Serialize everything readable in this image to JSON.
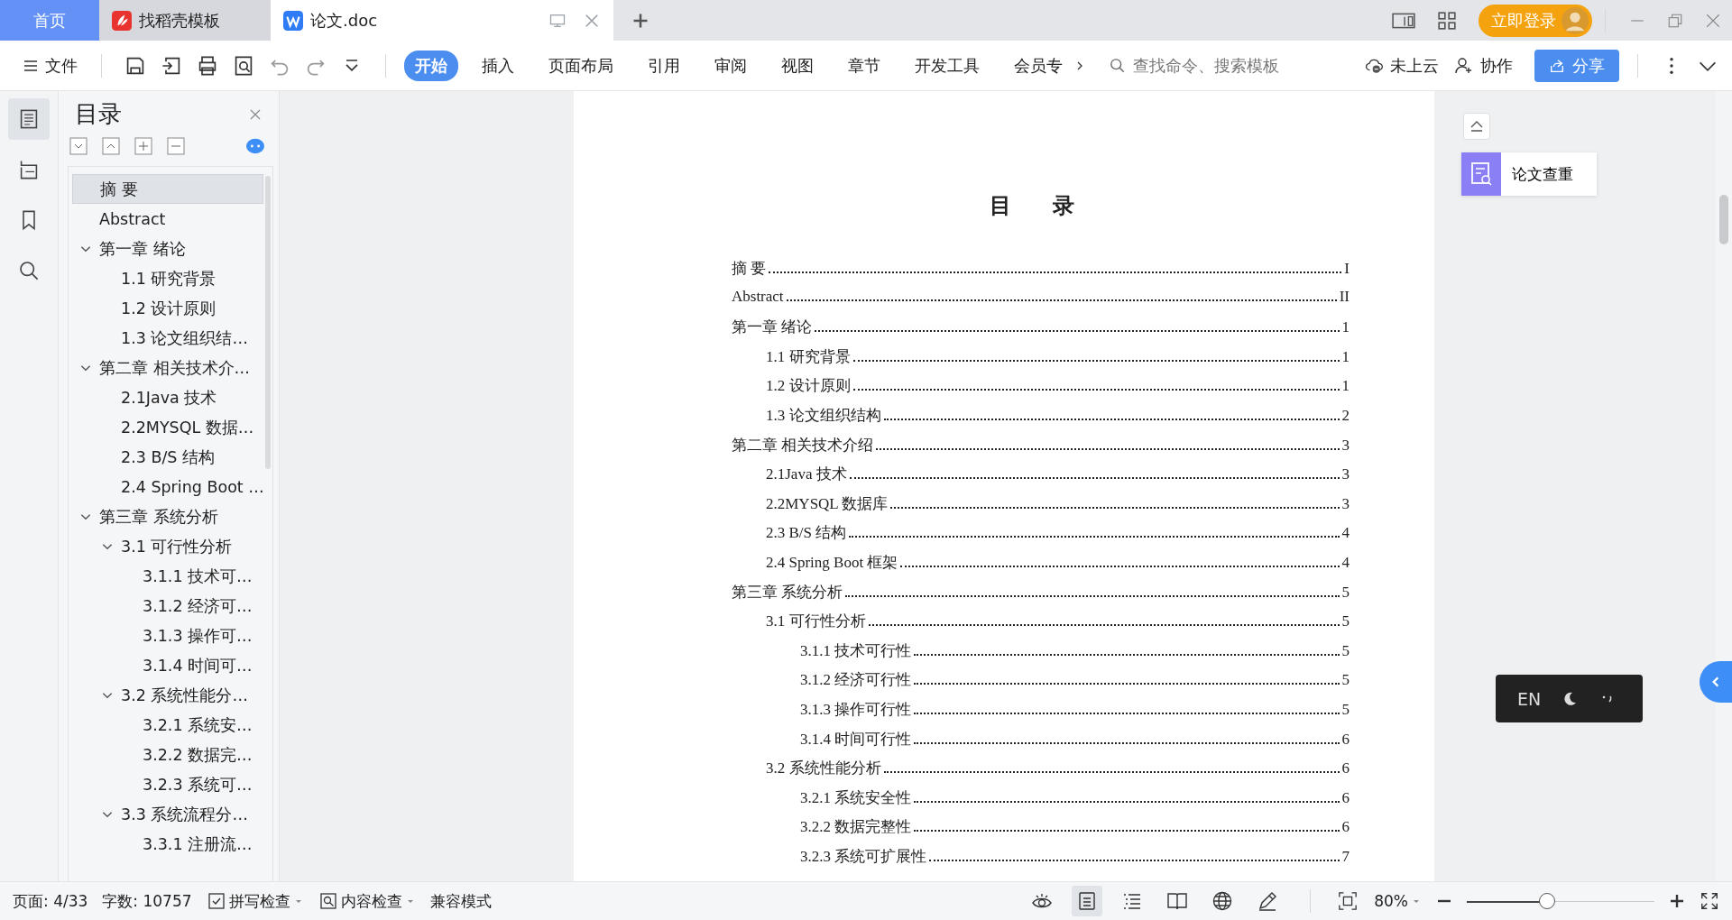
{
  "tabs": [
    {
      "label": "首页",
      "kind": "home",
      "selected": false
    },
    {
      "label": "找稻壳模板",
      "kind": "template",
      "selected": false
    },
    {
      "label": "论文.doc",
      "kind": "doc",
      "selected": true
    }
  ],
  "account": {
    "login": "立即登录"
  },
  "toolbar": {
    "file": "文件",
    "menus": [
      {
        "label": "开始",
        "selected": true
      },
      {
        "label": "插入",
        "selected": false
      },
      {
        "label": "页面布局",
        "selected": false
      },
      {
        "label": "引用",
        "selected": false
      },
      {
        "label": "审阅",
        "selected": false
      },
      {
        "label": "视图",
        "selected": false
      },
      {
        "label": "章节",
        "selected": false
      },
      {
        "label": "开发工具",
        "selected": false
      },
      {
        "label": "会员专",
        "selected": false
      }
    ],
    "search": {
      "placeholder": "查找命令、搜索模板"
    },
    "cloud": "未上云",
    "collab": "协作",
    "share": "分享"
  },
  "nav": {
    "title": "目录",
    "items": [
      {
        "label": "摘 要",
        "selected": true
      },
      {
        "label": "Abstract",
        "selected": false
      },
      {
        "label": "第一章 绪论",
        "selected": false,
        "expanded": true,
        "children": [
          {
            "label": "1.1 研究背景",
            "selected": false
          },
          {
            "label": "1.2  设计原则",
            "selected": false
          },
          {
            "label": "1.3  论文组织结…",
            "selected": false
          }
        ]
      },
      {
        "label": "第二章 相关技术介…",
        "selected": false,
        "expanded": true,
        "children": [
          {
            "label": "2.1Java 技术",
            "selected": false
          },
          {
            "label": "2.2MYSQL 数据…",
            "selected": false
          },
          {
            "label": "2.3 B/S 结构",
            "selected": false
          },
          {
            "label": "2.4 Spring Boot …",
            "selected": false
          }
        ]
      },
      {
        "label": "第三章 系统分析",
        "selected": false,
        "expanded": true,
        "children": [
          {
            "label": "3.1  可行性分析",
            "selected": false,
            "expanded": true,
            "children": [
              {
                "label": "3.1.1 技术可…",
                "selected": false
              },
              {
                "label": "3.1.2 经济可…",
                "selected": false
              },
              {
                "label": "3.1.3 操作可…",
                "selected": false
              },
              {
                "label": "3.1.4 时间可…",
                "selected": false
              }
            ]
          },
          {
            "label": "3.2 系统性能分…",
            "selected": false,
            "expanded": true,
            "children": [
              {
                "label": "3.2.1  系统安…",
                "selected": false
              },
              {
                "label": "3.2.2  数据完…",
                "selected": false
              },
              {
                "label": "3.2.3 系统可…",
                "selected": false
              }
            ]
          },
          {
            "label": "3.3 系统流程分…",
            "selected": false,
            "expanded": true,
            "children": [
              {
                "label": "3.3.1 注册流…",
                "selected": false
              }
            ]
          }
        ]
      }
    ]
  },
  "document": {
    "title": "目 录",
    "toc": [
      {
        "text": "摘 要",
        "page": "I"
      },
      {
        "text": "Abstract",
        "page": "II"
      },
      {
        "text": "第一章 绪论",
        "page": "1",
        "children": [
          {
            "text": "1.1 研究背景",
            "page": "1"
          },
          {
            "text": "1.2  设计原则",
            "page": "1"
          },
          {
            "text": "1.3  论文组织结构",
            "page": "2"
          }
        ]
      },
      {
        "text": "第二章 相关技术介绍",
        "page": "3",
        "children": [
          {
            "text": "2.1Java 技术",
            "page": "3"
          },
          {
            "text": "2.2MYSQL 数据库",
            "page": "3"
          },
          {
            "text": "2.3 B/S 结构",
            "page": "4"
          },
          {
            "text": "2.4 Spring Boot 框架",
            "page": "4"
          }
        ]
      },
      {
        "text": "第三章 系统分析",
        "page": "5",
        "children": [
          {
            "text": "3.1  可行性分析",
            "page": "5",
            "children": [
              {
                "text": "3.1.1 技术可行性",
                "page": "5"
              },
              {
                "text": "3.1.2 经济可行性",
                "page": "5"
              },
              {
                "text": "3.1.3 操作可行性",
                "page": "5"
              },
              {
                "text": "3.1.4 时间可行性",
                "page": "6"
              }
            ]
          },
          {
            "text": "3.2 系统性能分析",
            "page": "6",
            "children": [
              {
                "text": "3.2.1  系统安全性",
                "page": "6"
              },
              {
                "text": "3.2.2  数据完整性",
                "page": "6"
              },
              {
                "text": "3.2.3 系统可扩展性",
                "page": "7"
              }
            ]
          }
        ]
      }
    ]
  },
  "side_panel": {
    "check": "论文查重"
  },
  "ime": {
    "label": "EN"
  },
  "status_bar": {
    "page": "页面: 4/33",
    "words": "字数: 10757",
    "spell": "拼写检查",
    "content": "内容检查",
    "mode": "兼容模式",
    "view_modes": [
      {
        "kind": "read",
        "selected": false
      },
      {
        "kind": "page",
        "selected": true
      },
      {
        "kind": "outline",
        "selected": false
      },
      {
        "kind": "book",
        "selected": false
      },
      {
        "kind": "web",
        "selected": false
      },
      {
        "kind": "pen",
        "selected": false
      }
    ],
    "zoom": "80%",
    "zoom_slider": {
      "level": 0.43
    }
  }
}
